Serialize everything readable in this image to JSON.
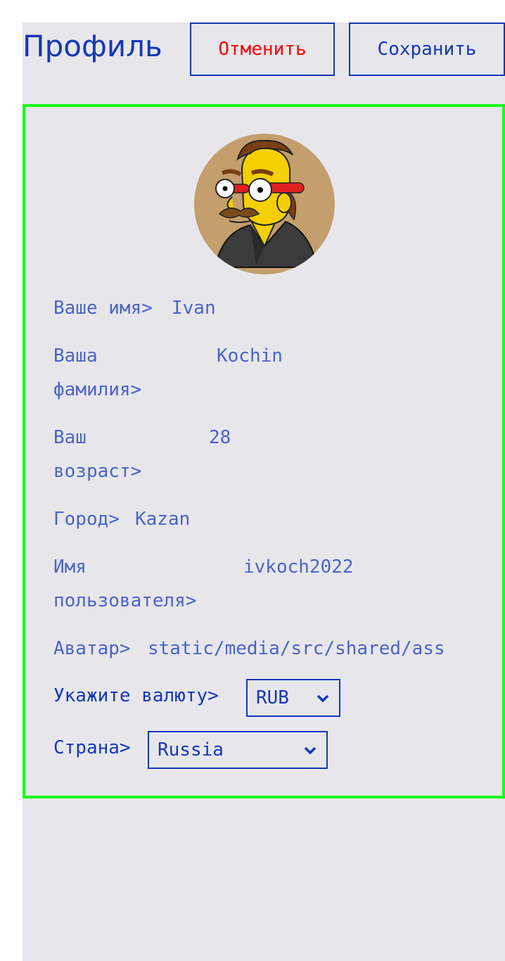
{
  "header": {
    "title": "Профиль",
    "cancel_label": "Отменить",
    "save_label": "Сохранить"
  },
  "profile": {
    "avatar_icon": "cartoon-avatar-icon",
    "fields": {
      "name": {
        "label": "Ваше имя>",
        "value": "Ivan"
      },
      "surname": {
        "label_line1": "Ваша",
        "label_line2": "фамилия>",
        "value": "Kochin"
      },
      "age": {
        "label_line1": "Ваш",
        "label_line2": "возраст>",
        "value": "28"
      },
      "city": {
        "label": "Город>",
        "value": "Kazan"
      },
      "username": {
        "label_line1": "Имя",
        "label_line2": "пользователя>",
        "value": "ivkoch2022"
      },
      "avatar": {
        "label": "Аватар>",
        "value": "static/media/src/shared/ass"
      }
    },
    "currency": {
      "label": "Укажите валюту>",
      "selected": "RUB"
    },
    "country": {
      "label": "Страна>",
      "selected": "Russia"
    }
  },
  "colors": {
    "accent": "#1637b8",
    "cancel": "#ff0000",
    "card_border": "#18ff18",
    "field_text": "#4a64c8",
    "background": "#e7e7eb"
  }
}
